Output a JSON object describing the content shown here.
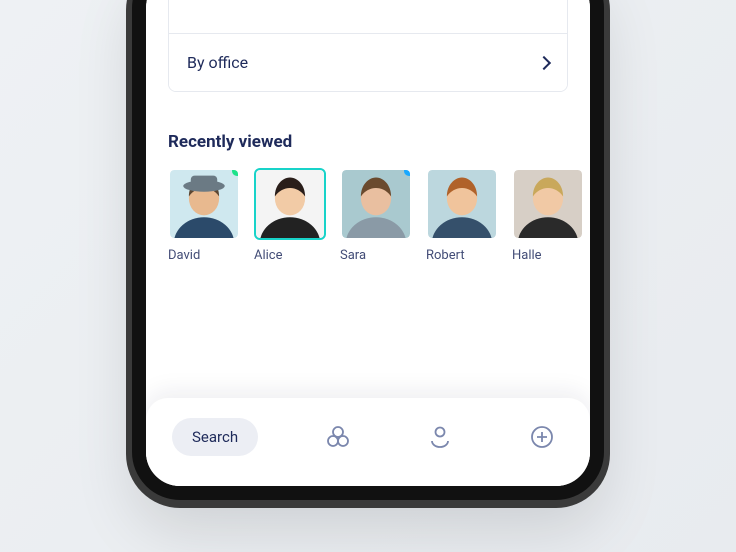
{
  "filters": {
    "row0": {
      "label": ""
    },
    "row1": {
      "label": "By office"
    }
  },
  "section": {
    "recently_viewed_title": "Recently viewed"
  },
  "people": [
    {
      "name": "David",
      "selected": false,
      "status": "#1de28a",
      "bg": "#cfe8ef",
      "shirt": "#2b4a6a",
      "skin": "#e8b98f",
      "hair": "#5a4632",
      "hat": "#6b7a84"
    },
    {
      "name": "Alice",
      "selected": true,
      "status": null,
      "bg": "#f4f4f4",
      "shirt": "#222",
      "skin": "#f2cba6",
      "hair": "#2a1e1a",
      "hat": null
    },
    {
      "name": "Sara",
      "selected": false,
      "status": "#1aa8ff",
      "bg": "#a9c9cf",
      "shirt": "#8a9aa6",
      "skin": "#e9bfa0",
      "hair": "#6a4a2e",
      "hat": null
    },
    {
      "name": "Robert",
      "selected": false,
      "status": null,
      "bg": "#bcd7de",
      "shirt": "#35506b",
      "skin": "#f0c49c",
      "hair": "#b0622a",
      "hat": null
    },
    {
      "name": "Halle",
      "selected": false,
      "status": null,
      "bg": "#d7cfc6",
      "shirt": "#2a2a2a",
      "skin": "#f1c9a5",
      "hair": "#c9a85b",
      "hat": null
    }
  ],
  "tabs": {
    "search_label": "Search"
  }
}
